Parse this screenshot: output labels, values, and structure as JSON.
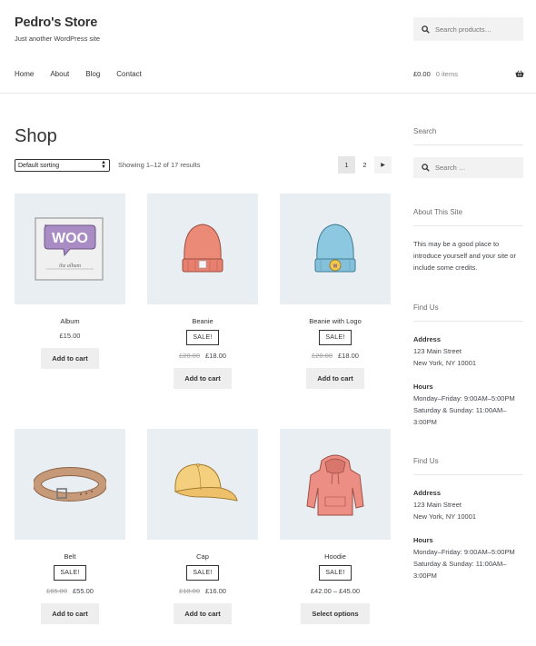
{
  "header": {
    "site_title": "Pedro's Store",
    "site_description": "Just another WordPress site",
    "search_placeholder": "Search products…",
    "nav": [
      "Home",
      "About",
      "Blog",
      "Contact"
    ],
    "cart_amount": "£0.00",
    "cart_count": "0 items"
  },
  "main": {
    "page_title": "Shop",
    "sorting": "Default sorting",
    "result_count": "Showing 1–12 of 17 results",
    "pagination": [
      "1",
      "2"
    ],
    "products": [
      {
        "name": "Album",
        "sale": "",
        "old_price": "",
        "price": "£15.00",
        "button": "Add to cart",
        "image": "album-image"
      },
      {
        "name": "Beanie",
        "sale": "SALE!",
        "old_price": "£20.00",
        "price": "£18.00",
        "button": "Add to cart",
        "image": "beanie-image"
      },
      {
        "name": "Beanie with Logo",
        "sale": "SALE!",
        "old_price": "£20.00",
        "price": "£18.00",
        "button": "Add to cart",
        "image": "beanie-logo-image"
      },
      {
        "name": "Belt",
        "sale": "SALE!",
        "old_price": "£65.00",
        "price": "£55.00",
        "button": "Add to cart",
        "image": "belt-image"
      },
      {
        "name": "Cap",
        "sale": "SALE!",
        "old_price": "£18.00",
        "price": "£16.00",
        "button": "Add to cart",
        "image": "cap-image"
      },
      {
        "name": "Hoodie",
        "sale": "SALE!",
        "old_price": "",
        "price": "£42.00 – £45.00",
        "button": "Select options",
        "image": "hoodie-image"
      }
    ]
  },
  "sidebar": {
    "search_title": "Search",
    "search_placeholder": "Search …",
    "about_title": "About This Site",
    "about_text": "This may be a good place to introduce yourself and your site or include some credits.",
    "find_us": [
      {
        "title": "Find Us",
        "address_label": "Address",
        "address_line1": "123 Main Street",
        "address_line2": "New York, NY 10001",
        "hours_label": "Hours",
        "hours_line1": "Monday–Friday: 9:00AM–5:00PM",
        "hours_line2": "Saturday & Sunday: 11:00AM–3:00PM"
      },
      {
        "title": "Find Us",
        "address_label": "Address",
        "address_line1": "123 Main Street",
        "address_line2": "New York, NY 10001",
        "hours_label": "Hours",
        "hours_line1": "Monday–Friday: 9:00AM–5:00PM",
        "hours_line2": "Saturday & Sunday: 11:00AM–3:00PM"
      }
    ]
  }
}
